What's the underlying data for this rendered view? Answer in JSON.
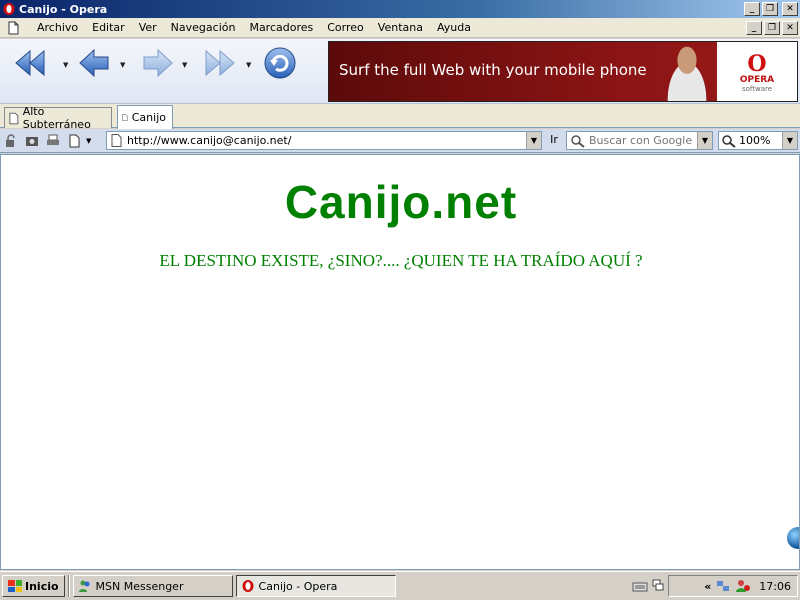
{
  "window": {
    "title": "Canijo - Opera",
    "controls": {
      "minimize": "_",
      "maximize": "❐",
      "close": "✕"
    }
  },
  "menu": {
    "items": [
      "Archivo",
      "Editar",
      "Ver",
      "Navegación",
      "Marcadores",
      "Correo",
      "Ventana",
      "Ayuda"
    ]
  },
  "toolbar": {
    "buttons": [
      "rewind-icon",
      "back-icon",
      "forward-icon",
      "fast-forward-icon",
      "reload-icon"
    ]
  },
  "banner": {
    "text": "Surf the full Web with your mobile phone",
    "logo_letter": "O",
    "logo_brand": "OPERA",
    "logo_sub": "software"
  },
  "tabs": [
    {
      "label": "Alto Subterráneo",
      "active": false
    },
    {
      "label": "Canijo",
      "active": true
    }
  ],
  "address": {
    "url": "http://www.canijo@canijo.net/",
    "go_label": "Ir",
    "search_placeholder": "Buscar con Google",
    "zoom": "100%"
  },
  "page": {
    "title": "Canijo.net",
    "tagline": "EL DESTINO EXISTE, ¿SINO?.... ¿QUIEN TE HA TRAÍDO AQUÍ ?",
    "color": "#008000"
  },
  "taskbar": {
    "start_label": "Inicio",
    "tasks": [
      {
        "label": "MSN Messenger",
        "active": false
      },
      {
        "label": "Canijo - Opera",
        "active": true
      }
    ],
    "tray_chevron": "«",
    "clock": "17:06"
  }
}
